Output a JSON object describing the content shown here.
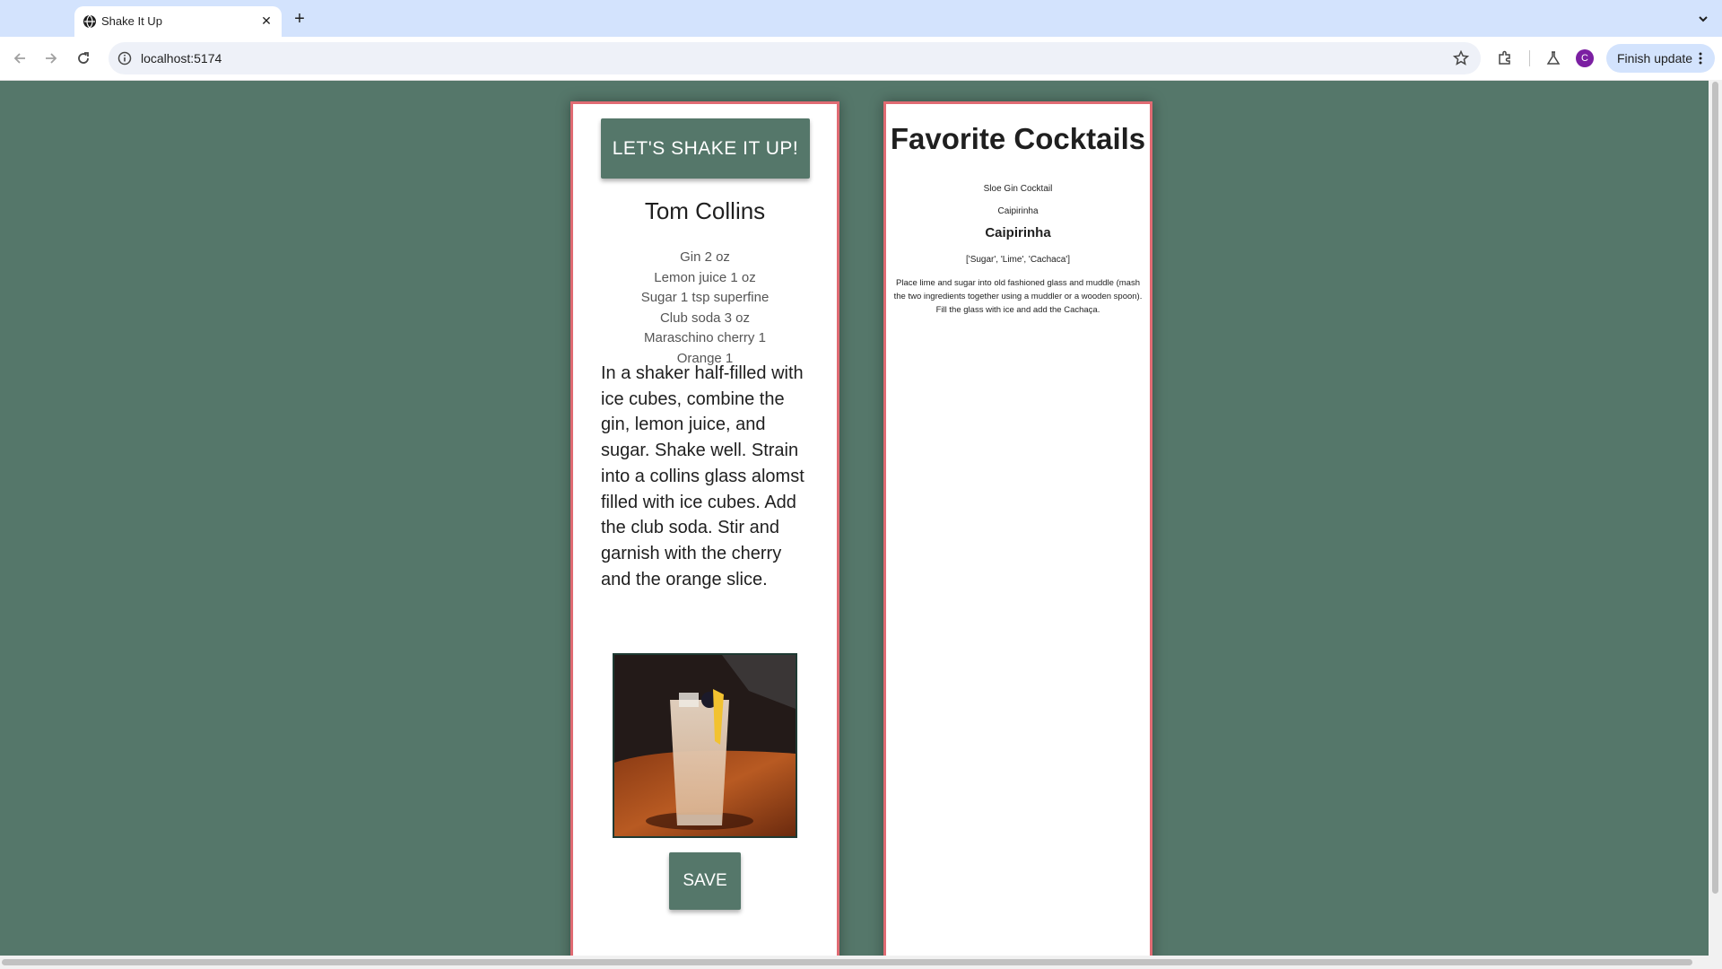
{
  "browser": {
    "tab_title": "Shake It Up",
    "url": "localhost:5174",
    "profile_initial": "C",
    "finish_update_label": "Finish update"
  },
  "left_card": {
    "shake_button_label": "LET'S SHAKE IT UP!",
    "drink_name": "Tom Collins",
    "ingredients": [
      "Gin 2 oz",
      "Lemon juice 1 oz",
      "Sugar 1 tsp superfine",
      "Club soda 3 oz",
      "Maraschino cherry 1",
      "Orange 1"
    ],
    "instructions": "In a shaker half-filled with ice cubes, combine the gin, lemon juice, and sugar. Shake well. Strain into a collins glass alomst filled with ice cubes. Add the club soda. Stir and garnish with the cherry and the orange slice.",
    "save_button_label": "SAVE"
  },
  "right_card": {
    "title": "Favorite Cocktails",
    "favorites": [
      "Sloe Gin Cocktail",
      "Caipirinha"
    ],
    "selected": {
      "name": "Caipirinha",
      "ingredients": "['Sugar', 'Lime', 'Cachaca']",
      "instructions": "Place lime and sugar into old fashioned glass and muddle (mash the two ingredients together using a muddler or a wooden spoon). Fill the glass with ice and add the Cachaça."
    }
  },
  "colors": {
    "page_background": "#55776a",
    "card_border": "#e06b73",
    "button": "#55776a"
  }
}
